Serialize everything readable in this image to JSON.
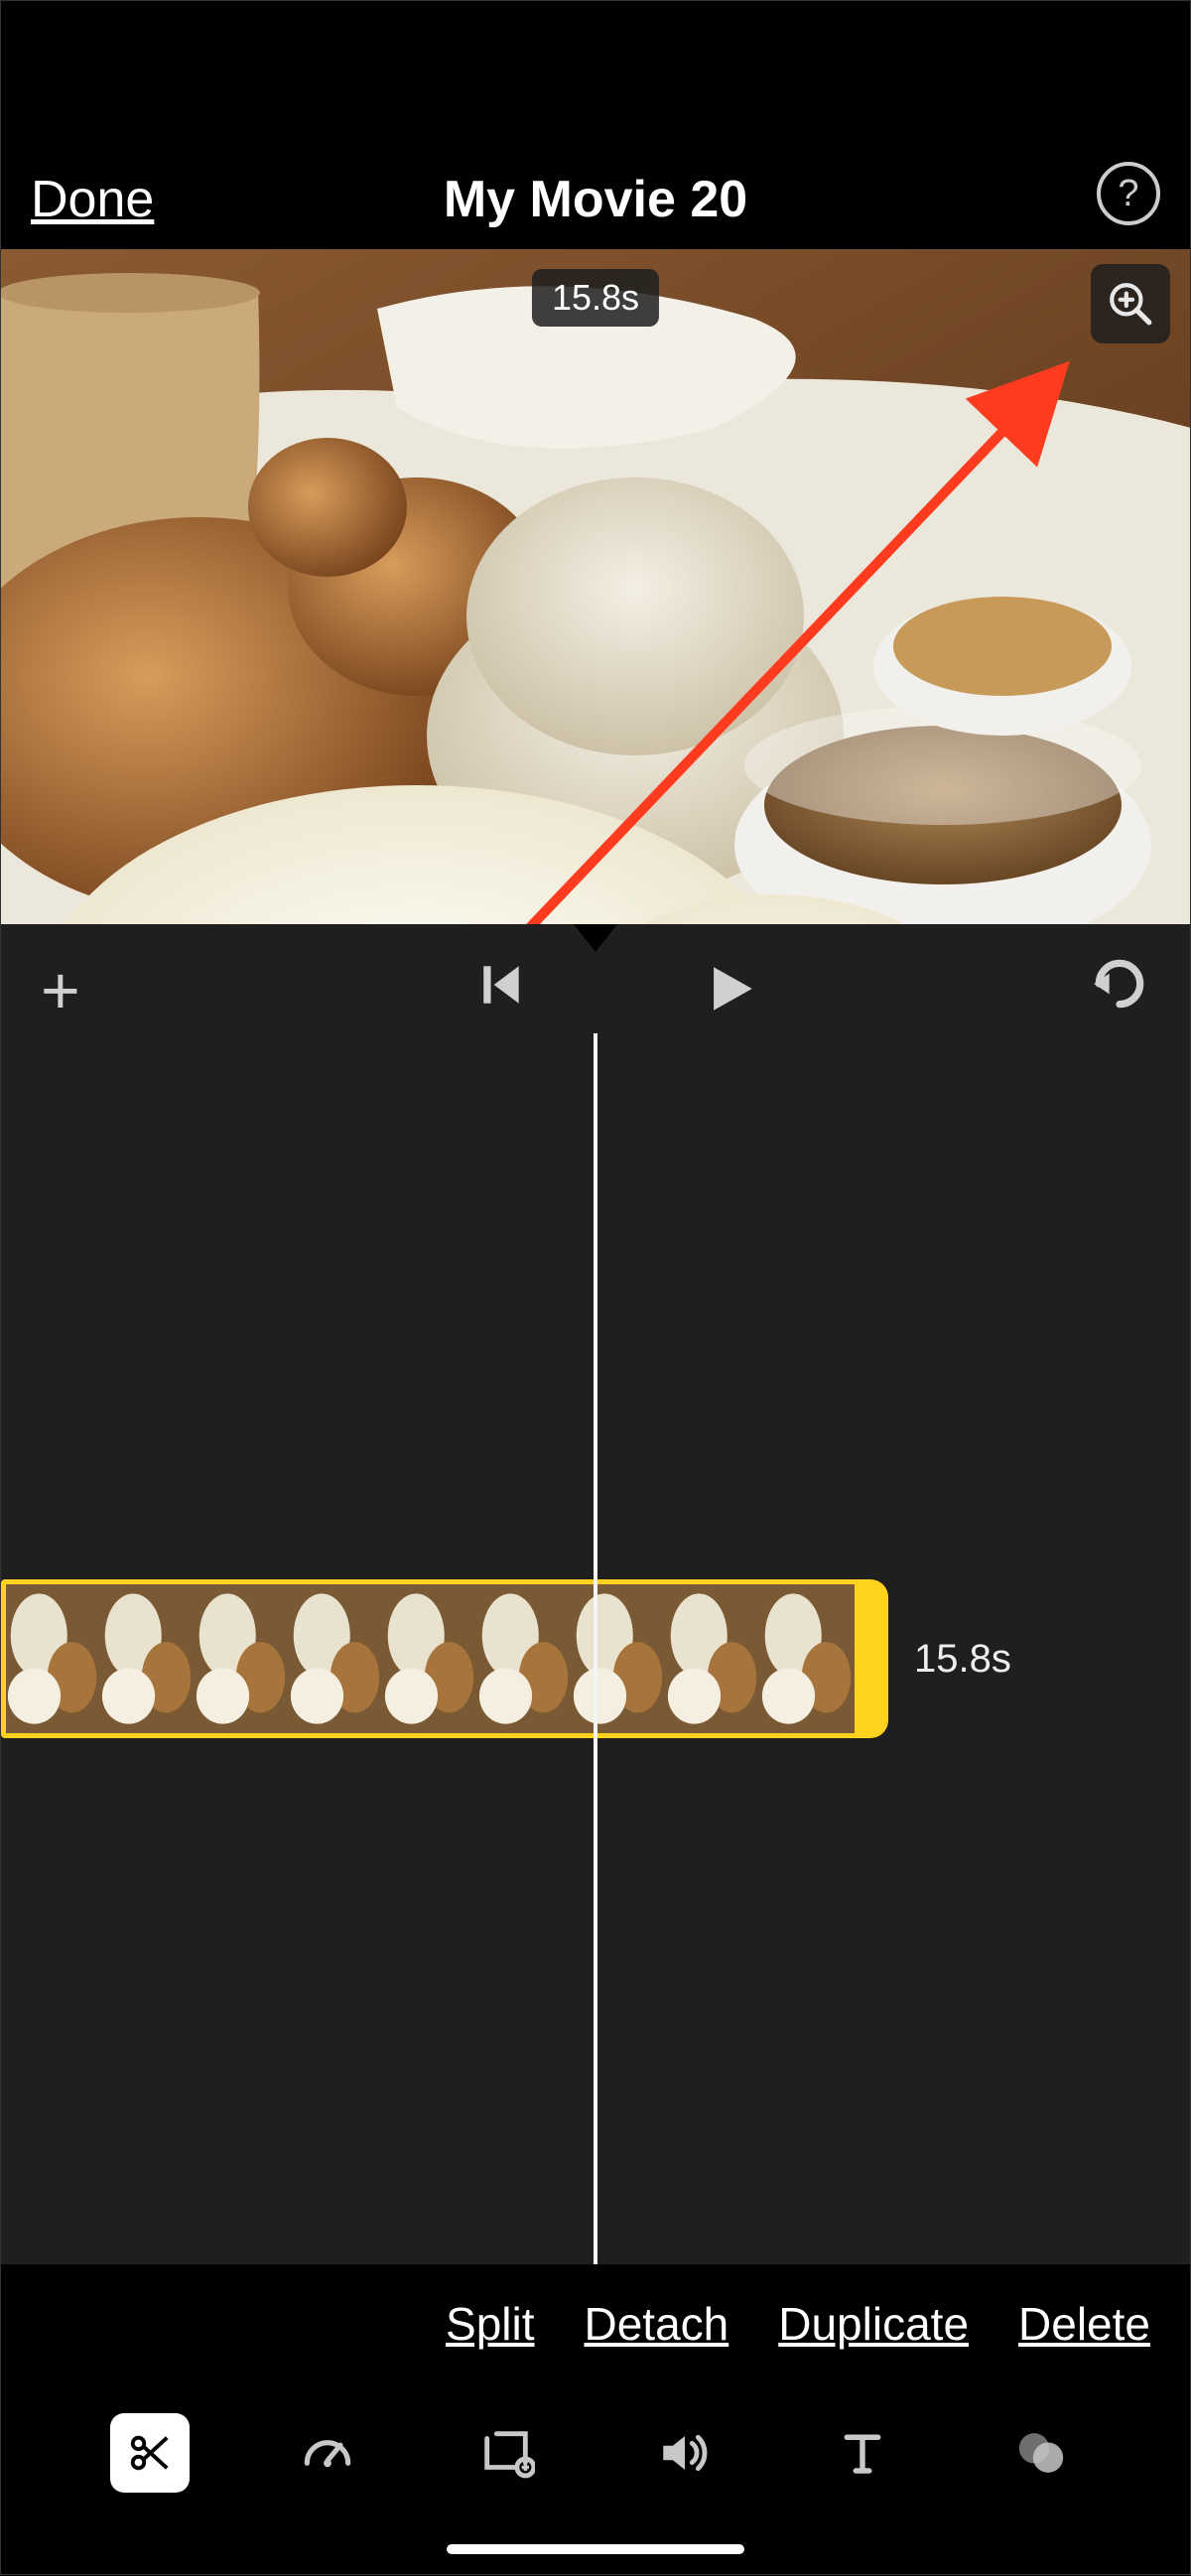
{
  "header": {
    "done_label": "Done",
    "title": "My Movie 20",
    "help_label": "?"
  },
  "preview": {
    "duration": "15.8s"
  },
  "timeline": {
    "clip_duration": "15.8s"
  },
  "actions": {
    "split": "Split",
    "detach": "Detach",
    "duplicate": "Duplicate",
    "delete": "Delete"
  },
  "tools": {
    "cut": "cut",
    "speed": "speed",
    "crop": "crop",
    "volume": "volume",
    "text": "text",
    "filters": "filters"
  }
}
